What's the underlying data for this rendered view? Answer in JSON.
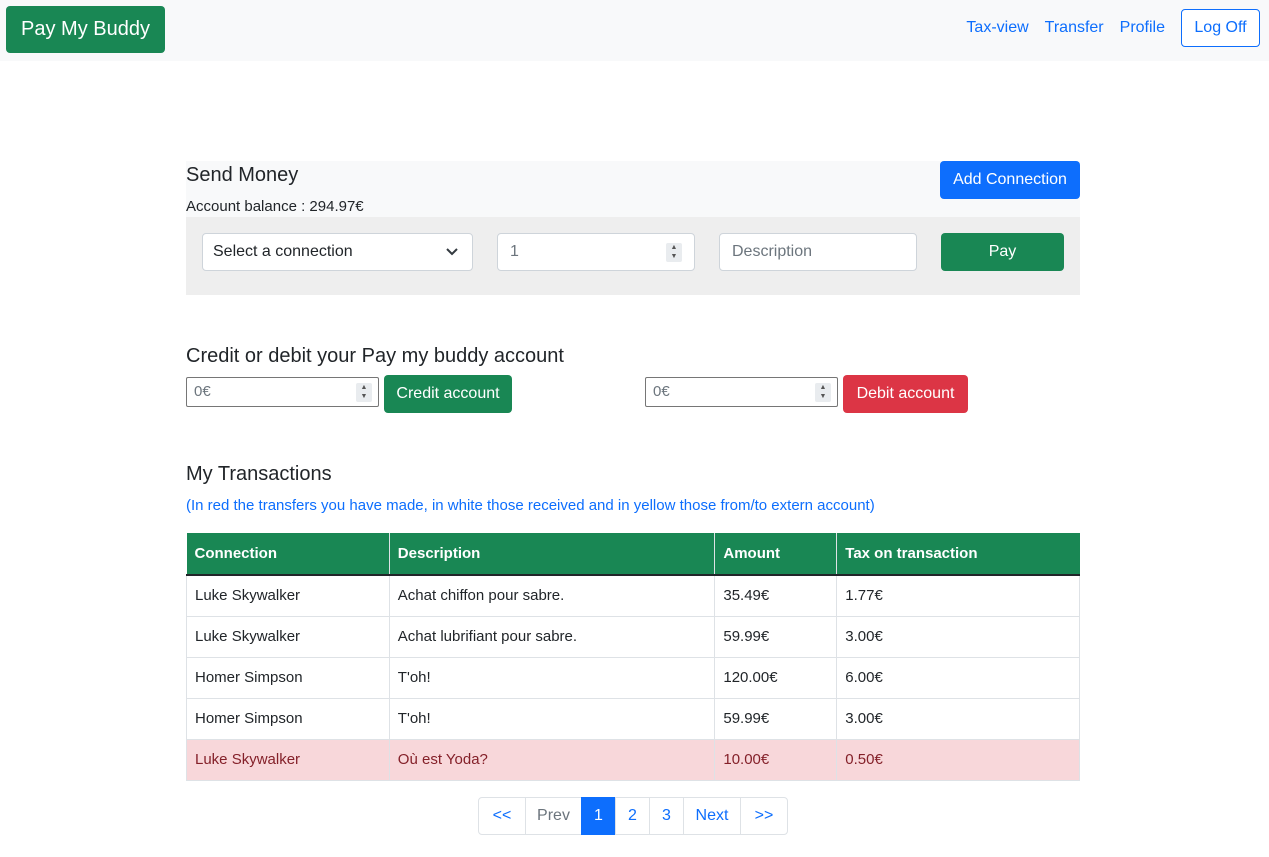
{
  "navbar": {
    "brand": "Pay My Buddy",
    "links": [
      "Tax-view",
      "Transfer",
      "Profile"
    ],
    "logoff": "Log Off"
  },
  "send": {
    "title": "Send Money",
    "balance": "Account balance : 294.97€",
    "add_connection": "Add Connection",
    "select_value": "Select a connection",
    "amount_value": "1",
    "description_placeholder": "Description",
    "pay_label": "Pay"
  },
  "account": {
    "title": "Credit or debit your Pay my buddy account",
    "credit_placeholder": "0€",
    "credit_label": "Credit account",
    "debit_placeholder": "0€",
    "debit_label": "Debit account"
  },
  "transactions": {
    "title": "My Transactions",
    "note": "(In red the transfers you have made, in white those received and in yellow those from/to extern account)",
    "headers": [
      "Connection",
      "Description",
      "Amount",
      "Tax on transaction"
    ],
    "rows": [
      {
        "connection": "Luke Skywalker",
        "description": "Achat chiffon pour sabre.",
        "amount": "35.49€",
        "tax": "1.77€"
      },
      {
        "connection": "Luke Skywalker",
        "description": "Achat lubrifiant pour sabre.",
        "amount": "59.99€",
        "tax": "3.00€"
      },
      {
        "connection": "Homer Simpson",
        "description": "T'oh!",
        "amount": "120.00€",
        "tax": "6.00€"
      },
      {
        "connection": "Homer Simpson",
        "description": "T'oh!",
        "amount": "59.99€",
        "tax": "3.00€"
      },
      {
        "connection": "Luke Skywalker",
        "description": "Où est Yoda?",
        "amount": "10.00€",
        "tax": "0.50€"
      }
    ]
  },
  "pagination": {
    "first": "<<",
    "prev": "Prev",
    "pages": [
      "1",
      "2",
      "3"
    ],
    "next": "Next",
    "last": ">>"
  }
}
